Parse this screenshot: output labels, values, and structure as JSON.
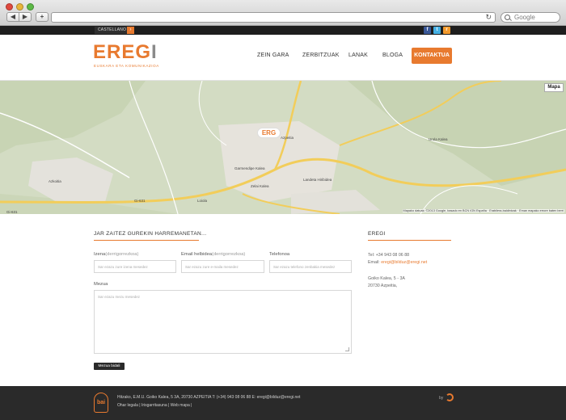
{
  "browser": {
    "search_placeholder": "Google",
    "reload_glyph": "↻"
  },
  "topbar": {
    "language_label": "CASTELLANO",
    "language_arrow": "›",
    "social": [
      {
        "name": "facebook-icon",
        "glyph": "f"
      },
      {
        "name": "twitter-icon",
        "glyph": "t"
      },
      {
        "name": "rss-icon",
        "glyph": "r"
      }
    ]
  },
  "header": {
    "logo_text_main": "EREG",
    "logo_text_end": "I",
    "logo_tagline": "EUSKARA ETA KOMUNIKAZIOA",
    "nav": [
      "ZEIN GARA",
      "ZERBITZUAK",
      "LANAK",
      "BLOGA"
    ],
    "cta": "KONTAKTUA"
  },
  "map": {
    "toggle_label": "Mapa",
    "credit": "Mapako datuak: ©2013 Google, basado en BCN IGN España · Erabilera-baldintzak · Eman mapako errore baten berri",
    "pin_label": "ERG",
    "labels": [
      "Azkoitia",
      "Azpeitia",
      "Loiola",
      "Urola Kalea",
      "Gi-631",
      "Gi-631",
      "Landeta Hiribidea",
      "Garmendipe Kalea",
      "Zelai Kalea"
    ]
  },
  "form": {
    "title": "JAR ZAITEZ GUREKIN HARREMANETAN...",
    "name_label": "Izena",
    "name_hint": "(derrigorrezkoa)",
    "name_placeholder": "Sar ezazu zure izena mesedez",
    "email_label": "Email helbidea",
    "email_hint": "(derrigorrezkoa)",
    "email_placeholder": "Sar ezazu zure e-maila mesedez",
    "phone_label": "Telefonoa",
    "phone_placeholder": "Sar ezazu telefono zenbakia mesedez",
    "message_label": "Mezua",
    "message_placeholder": "Sar ezazu mezu mesedez",
    "submit_label": "Mezua bidali"
  },
  "contact": {
    "title": "EREGI",
    "tel": "Tel: +34 943 08 06 88",
    "email_prefix": "Email: ",
    "email": "eregi@bilduz@eregi.net",
    "address_line1": "Goiko Kalea, 5 - 3A",
    "address_line2": "20730 Azpeitia,"
  },
  "footer": {
    "logo_glyph": "bai",
    "line1": "Hitzako, E.M.U. Goiko Kalea, 5 3A, 20730 AZPEITIA T: (+34) 943 08 06 88 E: eregi@bilduz@eregi.net",
    "links": [
      "Ohar legala",
      "Irisgarritasuna",
      "Web mapa"
    ],
    "by_label": "by"
  },
  "colors": {
    "accent": "#e87a2f",
    "dark": "#2a2a2a"
  }
}
